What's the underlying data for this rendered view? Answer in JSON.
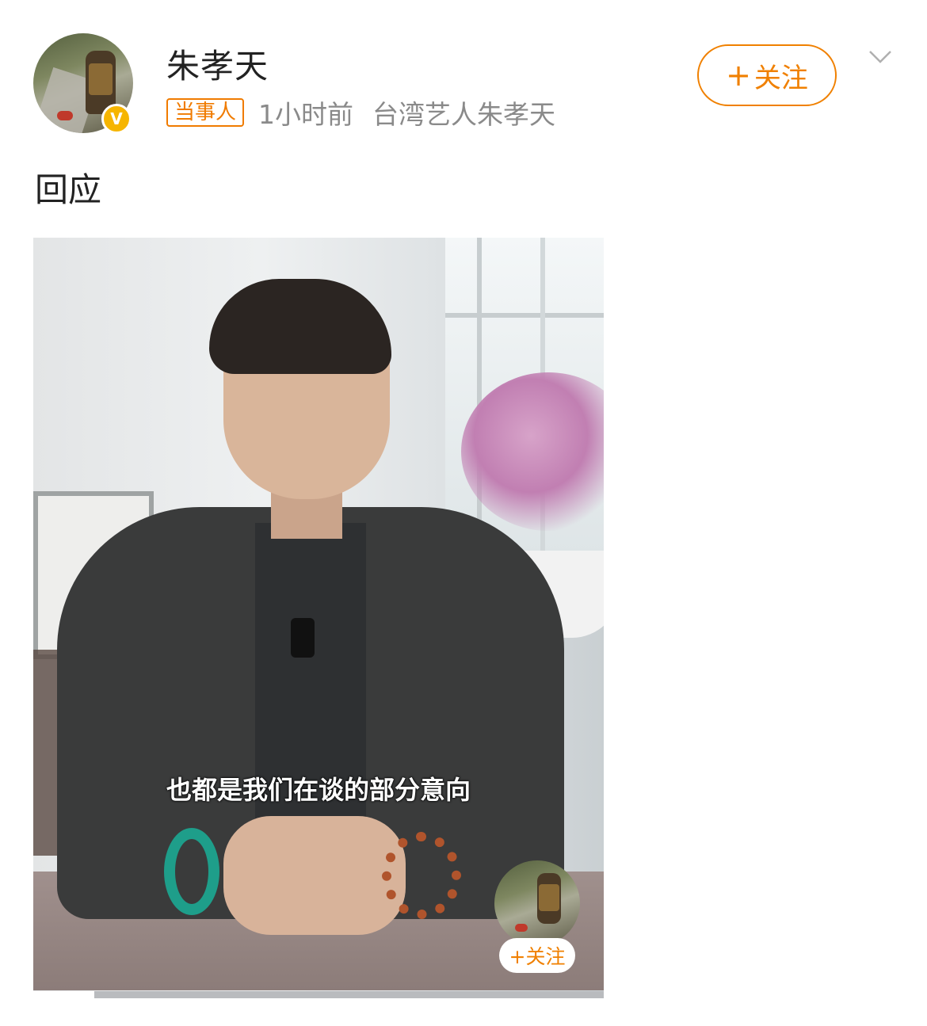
{
  "post": {
    "author": {
      "name": "朱孝天",
      "verified_badge": "V",
      "avatar_icon": "user-avatar"
    },
    "tag": "当事人",
    "time": "1小时前",
    "source": "台湾艺人朱孝天",
    "follow_button": {
      "plus": "+",
      "label": "关注"
    },
    "menu_icon": "chevron-down-icon",
    "text": "回应"
  },
  "video": {
    "subtitle": "也都是我们在谈的部分意向",
    "overlay_follow": "+关注",
    "progress": 0.107
  },
  "colors": {
    "accent": "#f08000",
    "verified": "#f6b500",
    "meta_text": "#8a8a8a"
  }
}
